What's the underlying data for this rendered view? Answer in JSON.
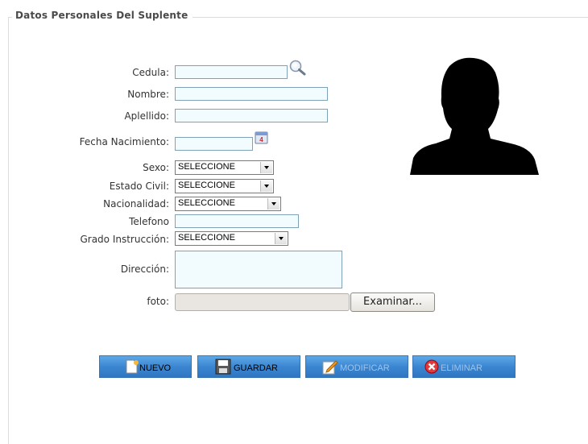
{
  "section": {
    "legend": "Datos Personales Del Suplente"
  },
  "labels": {
    "cedula": "Cedula:",
    "nombre": "Nombre:",
    "apellido": "Aplellido:",
    "fecha_nacimiento": "Fecha Nacimiento:",
    "sexo": "Sexo:",
    "estado_civil": "Estado Civil:",
    "nacionalidad": "Nacionalidad:",
    "telefono": "Telefono",
    "grado_instruccion": "Grado Instrucción:",
    "direccion": "Dirección:",
    "foto": "foto:"
  },
  "selects": {
    "sexo": "SELECCIONE",
    "estado_civil": "SELECCIONE",
    "nacionalidad": "SELECCIONE",
    "grado_instruccion": "SELECCIONE"
  },
  "file": {
    "browse_label": "Examinar..."
  },
  "buttons": {
    "nuevo": "NUEVO",
    "guardar": "GUARDAR",
    "modificar": "MODIFICAR",
    "eliminar": "ELIMINAR"
  },
  "icons": {
    "search": "magnifier-icon",
    "calendar": "calendar-icon",
    "photo": "person-silhouette-icon"
  }
}
